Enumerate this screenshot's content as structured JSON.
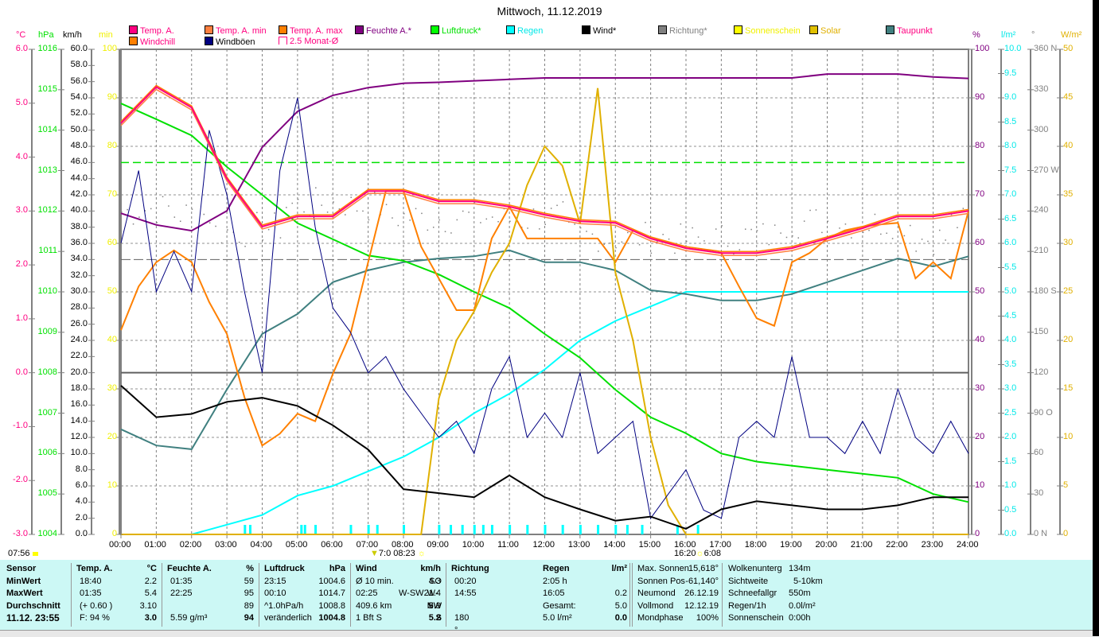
{
  "title": "Mittwoch, 11.12.2019",
  "legend": [
    {
      "label": "Temp. A.",
      "swatch": "#ff0080",
      "text": "#ff0080"
    },
    {
      "label": "Temp. A. min",
      "swatch": "#ff8040",
      "text": "#ff0080"
    },
    {
      "label": "Temp. A. max",
      "swatch": "#ff8000",
      "text": "#ff0080"
    },
    {
      "label": "Feuchte A.*",
      "swatch": "#800080",
      "text": "#800080"
    },
    {
      "label": "Luftdruck*",
      "swatch": "#00ff00",
      "text": "#00e000"
    },
    {
      "label": "Regen",
      "swatch": "#00ffff",
      "text": "#00e8e8"
    },
    {
      "label": "Wind*",
      "swatch": "#000000",
      "text": "#000000"
    },
    {
      "label": "Richtung*",
      "swatch": "#808080",
      "text": "#808080"
    },
    {
      "label": "Sonnenschein",
      "swatch": "#ffff00",
      "text": "#f0f000"
    },
    {
      "label": "Solar",
      "swatch": "#e0c000",
      "text": "#e0b000"
    },
    {
      "label": "Taupunkt",
      "swatch": "#408080",
      "text": "#ff0080"
    },
    {
      "label": "Windchill",
      "swatch": "#ff8000",
      "text": "#ff0080"
    },
    {
      "label": "Windböen",
      "swatch": "#000080",
      "text": "#000000"
    },
    {
      "label": "2.5 Monat-Ø",
      "swatch": "#ffffff",
      "text": "#ff0080"
    }
  ],
  "axes": {
    "left": [
      {
        "unit": "°C",
        "color": "#ff0080",
        "labels": [
          "6.0",
          "5.0",
          "4.0",
          "3.0",
          "2.0",
          "1.0",
          "0.0",
          "-1.0",
          "-2.0",
          "-3.0"
        ]
      },
      {
        "unit": "hPa",
        "color": "#00e000",
        "labels": [
          "1016",
          "1015",
          "1014",
          "1013",
          "1012",
          "1011",
          "1010",
          "1009",
          "1008",
          "1007",
          "1006",
          "1005",
          "1004"
        ]
      },
      {
        "unit": "km/h",
        "color": "#000000",
        "labels": [
          "60.0",
          "58.0",
          "56.0",
          "54.0",
          "52.0",
          "50.0",
          "48.0",
          "46.0",
          "44.0",
          "42.0",
          "40.0",
          "38.0",
          "36.0",
          "34.0",
          "32.0",
          "30.0",
          "28.0",
          "26.0",
          "24.0",
          "22.0",
          "20.0",
          "18.0",
          "16.0",
          "14.0",
          "12.0",
          "10.0",
          "8.0",
          "6.0",
          "4.0",
          "2.0",
          "0.0"
        ]
      },
      {
        "unit": "min",
        "color": "#f0f000",
        "labels": [
          "100",
          "90",
          "80",
          "70",
          "60",
          "50",
          "40",
          "30",
          "20",
          "10",
          "0"
        ]
      }
    ],
    "right": [
      {
        "unit": "%",
        "color": "#800080",
        "labels": [
          "100",
          "90",
          "80",
          "70",
          "60",
          "50",
          "40",
          "30",
          "20",
          "10",
          "0"
        ]
      },
      {
        "unit": "l/m²",
        "color": "#00e8e8",
        "labels": [
          "10.0",
          "9.5",
          "9.0",
          "8.5",
          "8.0",
          "7.5",
          "7.0",
          "6.5",
          "6.0",
          "5.5",
          "5.0",
          "4.5",
          "4.0",
          "3.5",
          "3.0",
          "2.5",
          "2.0",
          "1.5",
          "1.0",
          "0.5",
          "0.0"
        ]
      },
      {
        "unit": "°",
        "color": "#808080",
        "labels": [
          "360 N",
          "330",
          "300",
          "270 W",
          "240",
          "210",
          "180 S",
          "150",
          "120",
          "90 O",
          "60",
          "30",
          "0  N"
        ]
      },
      {
        "unit": "W/m²",
        "color": "#e0b000",
        "labels": [
          "50",
          "45",
          "40",
          "35",
          "30",
          "25",
          "20",
          "15",
          "10",
          "5",
          "0"
        ]
      }
    ],
    "x_labels": [
      "00:00",
      "01:00",
      "02:00",
      "03:00",
      "04:00",
      "05:00",
      "06:00",
      "07:00",
      "08:00",
      "09:00",
      "10:00",
      "11:00",
      "12:00",
      "13:00",
      "14:00",
      "15:00",
      "16:00",
      "17:00",
      "18:00",
      "19:00",
      "20:00",
      "21:00",
      "22:00",
      "23:00",
      "24:00"
    ]
  },
  "sun_markers": {
    "sunrise_left": "07:56",
    "mark_a": "7:0",
    "mark_b": "08:23",
    "mark_c": "16:20",
    "mark_d": "6:08"
  },
  "chart_data": {
    "type": "line",
    "title": "Mittwoch, 11.12.2019",
    "x_range_hours": [
      0,
      24
    ],
    "series": [
      {
        "name": "Temp. A.",
        "unit": "°C",
        "color": "#ff0080",
        "step_hours": 1,
        "values": [
          4.63,
          5.3,
          4.92,
          3.6,
          2.71,
          2.9,
          2.9,
          3.37,
          3.37,
          3.18,
          3.18,
          3.08,
          2.93,
          2.81,
          2.78,
          2.49,
          2.31,
          2.22,
          2.22,
          2.31,
          2.49,
          2.68,
          2.9,
          2.9,
          3.0
        ]
      },
      {
        "name": "Windchill",
        "unit": "°C",
        "color": "#ff8000",
        "step_hours": 0.5,
        "values": [
          0.79,
          1.6,
          2.05,
          2.27,
          2.05,
          1.31,
          0.72,
          -0.46,
          -1.35,
          -1.13,
          -0.76,
          -0.9,
          -0.02,
          0.72,
          2.05,
          3.37,
          3.37,
          2.34,
          1.75,
          1.16,
          1.16,
          2.49,
          3.08,
          2.49,
          2.49,
          2.49,
          2.49,
          2.49,
          2.05,
          2.64,
          2.49,
          2.41,
          2.31,
          2.27,
          2.22,
          1.6,
          1.01,
          0.87,
          2.05,
          2.22,
          2.49,
          2.64,
          2.71,
          2.75,
          2.78,
          1.75,
          2.05,
          1.75,
          3.0
        ]
      },
      {
        "name": "Taupunkt",
        "unit": "°C",
        "color": "#408080",
        "step_hours": 1,
        "values": [
          -1.05,
          -1.35,
          -1.42,
          -0.31,
          0.72,
          1.09,
          1.68,
          1.9,
          2.05,
          2.12,
          2.16,
          2.27,
          2.05,
          2.05,
          1.9,
          1.53,
          1.46,
          1.34,
          1.34,
          1.46,
          1.68,
          1.9,
          2.12,
          1.97,
          2.16
        ]
      },
      {
        "name": "Feuchte A.",
        "unit": "%",
        "color": "#800080",
        "step_hours": 1,
        "values": [
          66.2,
          63.8,
          62.6,
          66.7,
          79.8,
          87.2,
          90.5,
          92.1,
          93.0,
          93.2,
          93.5,
          93.8,
          94.1,
          94.1,
          94.1,
          94.1,
          94.1,
          94.1,
          94.1,
          94.1,
          94.9,
          94.9,
          94.9,
          94.3,
          94.0
        ]
      },
      {
        "name": "Luftdruck",
        "unit": "hPa",
        "color": "#00e000",
        "step_hours": 1,
        "values": [
          1014.66,
          1014.27,
          1013.87,
          1013.09,
          1012.4,
          1011.7,
          1011.3,
          1010.9,
          1010.77,
          1010.43,
          1010.0,
          1009.6,
          1008.96,
          1008.37,
          1007.58,
          1006.9,
          1006.5,
          1006.0,
          1005.8,
          1005.7,
          1005.6,
          1005.5,
          1005.4,
          1005.0,
          1004.8
        ]
      },
      {
        "name": "Wind",
        "unit": "km/h",
        "color": "#000000",
        "step_hours": 1,
        "values": [
          18.4,
          14.5,
          14.9,
          16.4,
          16.9,
          15.9,
          13.5,
          10.5,
          5.6,
          5.1,
          4.6,
          7.3,
          4.6,
          3.1,
          1.7,
          2.2,
          0.7,
          3.1,
          4.1,
          3.6,
          3.1,
          3.1,
          3.6,
          4.6,
          4.6
        ]
      },
      {
        "name": "Windböen",
        "unit": "km/h",
        "color": "#000080",
        "step_hours": 0.5,
        "values": [
          36,
          45,
          30,
          35,
          30,
          50,
          42,
          30,
          20,
          45,
          54,
          38,
          28,
          25,
          20,
          22,
          18,
          15,
          12,
          14,
          10,
          18,
          22,
          12,
          15,
          12,
          20,
          10,
          12,
          14,
          2,
          5,
          8,
          3,
          2,
          12,
          14,
          12,
          22,
          12,
          12,
          10,
          14,
          10,
          18,
          12,
          10,
          14,
          10
        ]
      },
      {
        "name": "Regen",
        "unit": "l/m²",
        "color": "#00ffff",
        "step_hours": 1,
        "values": [
          0,
          0,
          0,
          0.2,
          0.4,
          0.8,
          1.0,
          1.3,
          1.6,
          2.0,
          2.5,
          2.9,
          3.4,
          4.0,
          4.4,
          4.7,
          5.0,
          5.0,
          5.0,
          5.0,
          5.0,
          5.0,
          5.0,
          5.0,
          5.0
        ]
      },
      {
        "name": "Solar",
        "unit": "W/m²",
        "color": "#e0b000",
        "step_hours": 0.5,
        "values": [
          0,
          0,
          0,
          0,
          0,
          0,
          0,
          0,
          0,
          0,
          0,
          0,
          0,
          0,
          0,
          0,
          0,
          0,
          14,
          20,
          23,
          27,
          30,
          36,
          40,
          38,
          32,
          46,
          27,
          20,
          10,
          3,
          0,
          0,
          0,
          0,
          0,
          0,
          0,
          0,
          0,
          0,
          0,
          0,
          0,
          0,
          0,
          0,
          0
        ]
      },
      {
        "name": "Richtung",
        "unit": "°",
        "color": "#808080",
        "step_hours": 1,
        "values": [
          240,
          242,
          238,
          225,
          228,
          245,
          246,
          244,
          236,
          235,
          236,
          234,
          236,
          222,
          220,
          221,
          219,
          220,
          222,
          232,
          233,
          231,
          232,
          220,
          232
        ]
      }
    ],
    "rain_event_hours": [
      3.5,
      3.65,
      5.1,
      5.2,
      5.5,
      6.5,
      7.0,
      7.25,
      8.0,
      9.0,
      9.33,
      9.66,
      10.0,
      10.25,
      10.5,
      11.0,
      11.5,
      12.0,
      12.5,
      13.0,
      13.5,
      14.0,
      14.33,
      14.75,
      15.75,
      16.33
    ],
    "reference_lines": {
      "luftdruck_avg_hpa": 1013.2,
      "km_h_line": 20,
      "temp_avg_c": 2.1
    }
  },
  "panel": {
    "sensor": {
      "head": "Sensor",
      "rows": [
        "MinWert",
        "MaxWert",
        "Durchschnitt",
        "11.12. 23:55"
      ]
    },
    "temp": {
      "head": "Temp. A.",
      "unit": "°C",
      "t": [
        "18:40",
        "01:35",
        "(+ 0.60 )",
        "F: 94 %"
      ],
      "v": [
        "2.2",
        "5.4",
        "3.10",
        "3.0"
      ]
    },
    "hum": {
      "head": "Feuchte A.",
      "unit": "%",
      "t": [
        "01:35",
        "22:25",
        "",
        "5.59 g/m³"
      ],
      "v": [
        "59",
        "95",
        "89",
        "94"
      ]
    },
    "press": {
      "head": "Luftdruck",
      "unit": "hPa",
      "t": [
        "23:15",
        "00:10",
        "^1.0hPa/h",
        "veränderlich"
      ],
      "v": [
        "1004.6",
        "1014.7",
        "1008.8",
        "1004.8"
      ]
    },
    "wind": {
      "head": "Wind",
      "unit": "km/h",
      "t": [
        "Ø 10 min.",
        "02:25",
        "409.6 km",
        "1 Bft S"
      ],
      "m": [
        "",
        "W-SW",
        "",
        " "
      ],
      "v": [
        "4.3",
        "21.4",
        "6.9",
        "5.2"
      ]
    },
    "dir": {
      "head": "Richtung",
      "t": [
        "00:20",
        "14:55",
        "",
        "180 °"
      ],
      "v": [
        "SO",
        "W-NW",
        "SW",
        "S"
      ]
    },
    "rain": {
      "head": "Regen",
      "unit": "l/m²",
      "t": [
        "2:05 h",
        "16:05",
        "Gesamt:",
        "5.0 l/m²"
      ],
      "v": [
        "",
        "0.2",
        "5.0",
        "0.0"
      ]
    },
    "astro": [
      [
        "Max. Sonnen",
        "15,618°"
      ],
      [
        "Sonnen Pos",
        "-61,140°"
      ],
      [
        "Neumond",
        "26.12.19"
      ],
      [
        "Vollmond",
        "12.12.19"
      ],
      [
        "Mondphase",
        "100%"
      ]
    ],
    "misc": [
      [
        "Wolkenunterg",
        "134m"
      ],
      [
        "Sichtweite",
        "5-10km"
      ],
      [
        "Schneefallgr",
        "550m"
      ],
      [
        "Regen/1h",
        "0.0l/m²"
      ],
      [
        "Sonnenschein",
        "0:00h"
      ]
    ]
  }
}
